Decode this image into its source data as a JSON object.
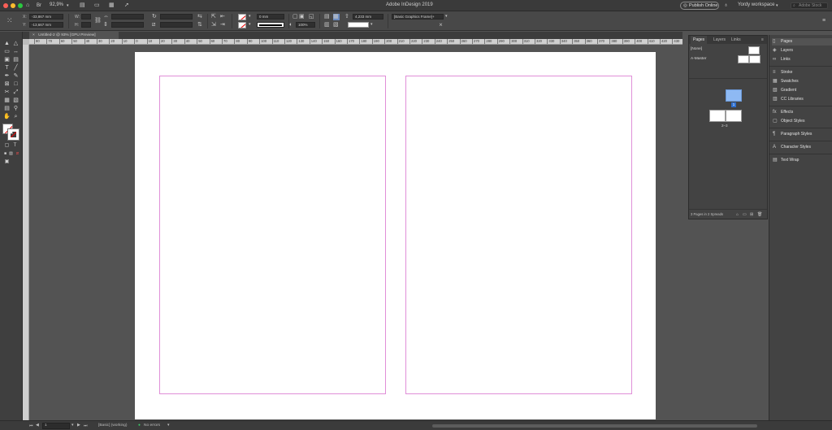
{
  "app": {
    "window_title": "Adobe InDesign 2019",
    "zoom_level": "92,9%",
    "publish_label": "Publish Online",
    "workspace_label": "Yordy workspace",
    "search_placeholder": "Adobe Stock"
  },
  "control_bar": {
    "x_label": "X:",
    "x_value": "-33,867 mm",
    "y_label": "Y:",
    "y_value": "-13,667 mm",
    "w_label": "W:",
    "h_label": "H:",
    "stroke_weight": "0 mm",
    "opacity": "100%",
    "stroke_offset": "4,233 mm",
    "object_style": "[Basic Graphics Frame]+",
    "icons": [
      "selection-icon",
      "rotate-icon",
      "flip-icon",
      "fill-icon",
      "stroke-icon",
      "align-icon",
      "frame-fitting-icon"
    ]
  },
  "document_tab": {
    "label": "Untitled-2 @ 93% [GPU Preview]",
    "close_glyph": "×"
  },
  "ruler": {
    "ticks": [
      "80",
      "70",
      "60",
      "50",
      "40",
      "30",
      "20",
      "10",
      "0",
      "10",
      "20",
      "30",
      "40",
      "50",
      "60",
      "70",
      "80",
      "90",
      "100",
      "110",
      "120",
      "130",
      "140",
      "150",
      "160",
      "170",
      "180",
      "190",
      "200",
      "210",
      "220",
      "230",
      "240",
      "250",
      "260",
      "270",
      "280",
      "290",
      "300",
      "310",
      "320",
      "330",
      "340",
      "350",
      "360",
      "370",
      "380",
      "390",
      "400",
      "410",
      "420",
      "430"
    ]
  },
  "tools": {
    "items": [
      {
        "name": "selection-tool-icon",
        "glyph": "▲"
      },
      {
        "name": "direct-selection-tool-icon",
        "glyph": "△"
      },
      {
        "name": "page-tool-icon",
        "glyph": "▭"
      },
      {
        "name": "gap-tool-icon",
        "glyph": "↔"
      },
      {
        "name": "content-collector-icon",
        "glyph": "▣"
      },
      {
        "name": "content-placer-icon",
        "glyph": "▤"
      },
      {
        "name": "type-tool-icon",
        "glyph": "T"
      },
      {
        "name": "line-tool-icon",
        "glyph": "╱"
      },
      {
        "name": "pen-tool-icon",
        "glyph": "✒"
      },
      {
        "name": "pencil-tool-icon",
        "glyph": "✎"
      },
      {
        "name": "rectangle-frame-tool-icon",
        "glyph": "⊠"
      },
      {
        "name": "rectangle-tool-icon",
        "glyph": "□"
      },
      {
        "name": "scissors-tool-icon",
        "glyph": "✂"
      },
      {
        "name": "free-transform-tool-icon",
        "glyph": "⤢"
      },
      {
        "name": "gradient-swatch-tool-icon",
        "glyph": "▦"
      },
      {
        "name": "gradient-feather-tool-icon",
        "glyph": "▧"
      },
      {
        "name": "note-tool-icon",
        "glyph": "▤"
      },
      {
        "name": "eyedropper-tool-icon",
        "glyph": "⚲"
      },
      {
        "name": "hand-tool-icon",
        "glyph": "✋"
      },
      {
        "name": "zoom-tool-icon",
        "glyph": "⌕"
      }
    ]
  },
  "pages_panel": {
    "tabs": [
      "Pages",
      "Layers",
      "Links"
    ],
    "masters": [
      {
        "label": "[None]"
      },
      {
        "label": "A-Master"
      }
    ],
    "page_one_label": "1",
    "spread_label": "2–3",
    "footer_text": "3 Pages in 2 Spreads"
  },
  "dock": {
    "items": [
      {
        "label": "Pages",
        "icon": "pages-icon",
        "glyph": "▯"
      },
      {
        "label": "Layers",
        "icon": "layers-icon",
        "glyph": "◈"
      },
      {
        "label": "Links",
        "icon": "links-icon",
        "glyph": "∞"
      },
      {
        "label": "Stroke",
        "icon": "stroke-icon",
        "glyph": "≡"
      },
      {
        "label": "Swatches",
        "icon": "swatches-icon",
        "glyph": "▦"
      },
      {
        "label": "Gradient",
        "icon": "gradient-icon",
        "glyph": "▧"
      },
      {
        "label": "CC Libraries",
        "icon": "cc-libraries-icon",
        "glyph": "▥"
      },
      {
        "label": "Effects",
        "icon": "effects-icon",
        "glyph": "fx"
      },
      {
        "label": "Object Styles",
        "icon": "object-styles-icon",
        "glyph": "▢"
      },
      {
        "label": "Paragraph Styles",
        "icon": "paragraph-styles-icon",
        "glyph": "¶"
      },
      {
        "label": "Character Styles",
        "icon": "character-styles-icon",
        "glyph": "A"
      },
      {
        "label": "Text Wrap",
        "icon": "text-wrap-icon",
        "glyph": "▤"
      }
    ]
  },
  "status_bar": {
    "page_number": "1",
    "working_label": "[Basic] (working)",
    "errors_label": "No errors"
  },
  "colors": {
    "margin_guide": "#e08fd8",
    "ui_dark": "#3a3a3a",
    "pasteboard": "#535353",
    "accent_blue": "#8eb9f3"
  }
}
